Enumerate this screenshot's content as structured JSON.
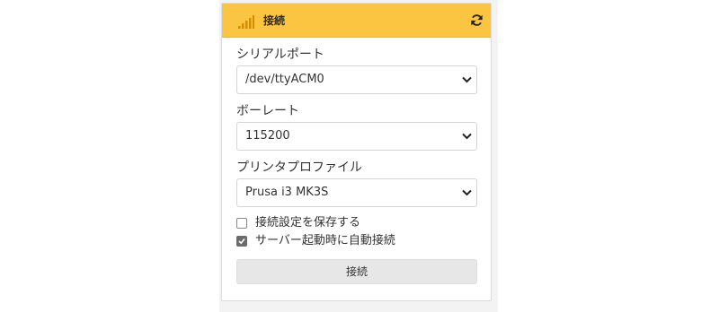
{
  "panel": {
    "title": "接続",
    "accent_color": "#fcc541",
    "header_icon": "signal-icon",
    "refresh_icon": "refresh-icon"
  },
  "fields": {
    "serial_port": {
      "label": "シリアルポート",
      "value": "/dev/ttyACM0"
    },
    "baudrate": {
      "label": "ボーレート",
      "value": "115200"
    },
    "printer_profile": {
      "label": "プリンタプロファイル",
      "value": "Prusa i3 MK3S"
    }
  },
  "options": {
    "save_settings": {
      "label": "接続設定を保存する",
      "checked": false
    },
    "auto_connect": {
      "label": "サーバー起動時に自動接続",
      "checked": true
    }
  },
  "actions": {
    "connect_label": "接続"
  }
}
